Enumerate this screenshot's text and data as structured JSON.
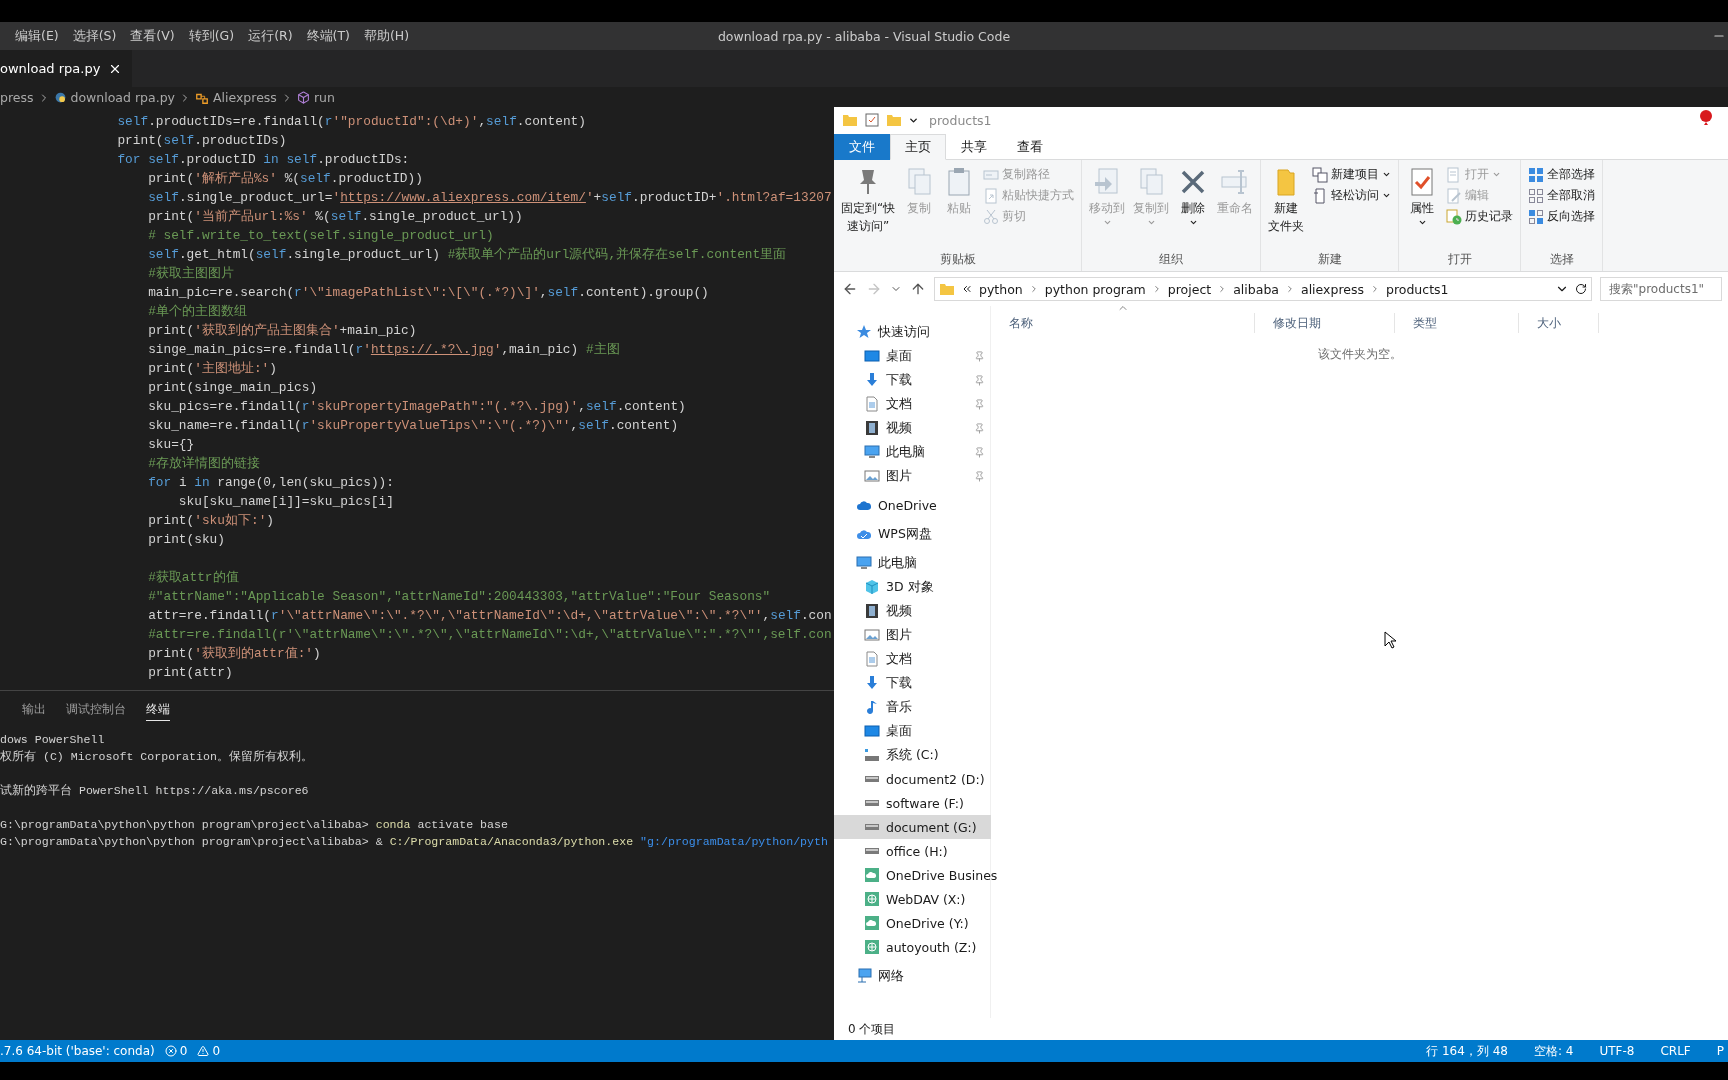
{
  "vscode": {
    "menu": [
      "编辑(E)",
      "选择(S)",
      "查看(V)",
      "转到(G)",
      "运行(R)",
      "终端(T)",
      "帮助(H)"
    ],
    "title": "download rpa.py - alibaba - Visual Studio Code",
    "tab": {
      "label": "ownload rpa.py"
    },
    "breadcrumb": [
      {
        "label": "press",
        "kind": "folder"
      },
      {
        "label": "download rpa.py",
        "kind": "python"
      },
      {
        "label": "Aliexpress",
        "kind": "class"
      },
      {
        "label": "run",
        "kind": "method"
      }
    ],
    "code": [
      {
        "tokens": [
          {
            "kind": "self",
            "text": "        self"
          },
          {
            "kind": "plain",
            "text": ".productIDs=re.findall("
          },
          {
            "kind": "keyword",
            "text": "r"
          },
          {
            "kind": "string",
            "text": "'\"productId\":(\\d+)'"
          },
          {
            "kind": "plain",
            "text": ","
          },
          {
            "kind": "self",
            "text": "self"
          },
          {
            "kind": "plain",
            "text": ".content)"
          }
        ]
      },
      {
        "tokens": [
          {
            "kind": "plain",
            "text": "        print("
          },
          {
            "kind": "self",
            "text": "self"
          },
          {
            "kind": "plain",
            "text": ".productIDs)"
          }
        ]
      },
      {
        "tokens": [
          {
            "kind": "keyword",
            "text": "        for "
          },
          {
            "kind": "self",
            "text": "self"
          },
          {
            "kind": "plain",
            "text": ".productID "
          },
          {
            "kind": "keyword",
            "text": "in "
          },
          {
            "kind": "self",
            "text": "self"
          },
          {
            "kind": "plain",
            "text": ".productIDs:"
          }
        ]
      },
      {
        "tokens": [
          {
            "kind": "plain",
            "text": "            print("
          },
          {
            "kind": "string",
            "text": "'解析产品%s'"
          },
          {
            "kind": "plain",
            "text": " %("
          },
          {
            "kind": "self",
            "text": "self"
          },
          {
            "kind": "plain",
            "text": ".productID))"
          }
        ]
      },
      {
        "tokens": [
          {
            "kind": "self",
            "text": "            self"
          },
          {
            "kind": "plain",
            "text": ".single_product_url="
          },
          {
            "kind": "string",
            "text": "'"
          },
          {
            "kind": "url",
            "text": "https://www.aliexpress.com/item/"
          },
          {
            "kind": "string",
            "text": "'"
          },
          {
            "kind": "plain",
            "text": "+"
          },
          {
            "kind": "self",
            "text": "self"
          },
          {
            "kind": "plain",
            "text": ".productID+"
          },
          {
            "kind": "string",
            "text": "'.html?af=13207"
          }
        ]
      },
      {
        "tokens": [
          {
            "kind": "plain",
            "text": "            print("
          },
          {
            "kind": "string",
            "text": "'当前产品url:%s'"
          },
          {
            "kind": "plain",
            "text": " %("
          },
          {
            "kind": "self",
            "text": "self"
          },
          {
            "kind": "plain",
            "text": ".single_product_url))"
          }
        ]
      },
      {
        "tokens": [
          {
            "kind": "comment",
            "text": "            # self.write_to_text(self.single_product_url)"
          }
        ]
      },
      {
        "tokens": [
          {
            "kind": "self",
            "text": "            self"
          },
          {
            "kind": "plain",
            "text": ".get_html("
          },
          {
            "kind": "self",
            "text": "self"
          },
          {
            "kind": "plain",
            "text": ".single_product_url) "
          },
          {
            "kind": "comment",
            "text": "#获取单个产品的url源代码,并保存在self.content里面"
          }
        ]
      },
      {
        "tokens": [
          {
            "kind": "comment",
            "text": "            #获取主图图片"
          }
        ]
      },
      {
        "tokens": [
          {
            "kind": "plain",
            "text": "            main_pic=re.search("
          },
          {
            "kind": "keyword",
            "text": "r"
          },
          {
            "kind": "string",
            "text": "'\\\"imagePathList\\\":\\[\\\"(.*?)\\]'"
          },
          {
            "kind": "plain",
            "text": ","
          },
          {
            "kind": "self",
            "text": "self"
          },
          {
            "kind": "plain",
            "text": ".content).group()"
          }
        ]
      },
      {
        "tokens": [
          {
            "kind": "comment",
            "text": "            #单个的主图数组"
          }
        ]
      },
      {
        "tokens": [
          {
            "kind": "plain",
            "text": "            print("
          },
          {
            "kind": "string",
            "text": "'获取到的产品主图集合'"
          },
          {
            "kind": "plain",
            "text": "+main_pic)"
          }
        ]
      },
      {
        "tokens": [
          {
            "kind": "plain",
            "text": "            singe_main_pics=re.findall("
          },
          {
            "kind": "keyword",
            "text": "r"
          },
          {
            "kind": "string",
            "text": "'"
          },
          {
            "kind": "url",
            "text": "https://.*?\\.jpg"
          },
          {
            "kind": "string",
            "text": "'"
          },
          {
            "kind": "plain",
            "text": ",main_pic) "
          },
          {
            "kind": "comment",
            "text": "#主图"
          }
        ]
      },
      {
        "tokens": [
          {
            "kind": "plain",
            "text": "            print("
          },
          {
            "kind": "string",
            "text": "'主图地址:'"
          },
          {
            "kind": "plain",
            "text": ")"
          }
        ]
      },
      {
        "tokens": [
          {
            "kind": "plain",
            "text": "            print(singe_main_pics)"
          }
        ]
      },
      {
        "tokens": [
          {
            "kind": "plain",
            "text": "            sku_pics=re.findall("
          },
          {
            "kind": "keyword",
            "text": "r"
          },
          {
            "kind": "string",
            "text": "'skuPropertyImagePath\":\"(.*?\\.jpg)'"
          },
          {
            "kind": "plain",
            "text": ","
          },
          {
            "kind": "self",
            "text": "self"
          },
          {
            "kind": "plain",
            "text": ".content)"
          }
        ]
      },
      {
        "tokens": [
          {
            "kind": "plain",
            "text": "            sku_name=re.findall("
          },
          {
            "kind": "keyword",
            "text": "r"
          },
          {
            "kind": "string",
            "text": "'skuPropertyValueTips\\\":\\\"(.*?)\\\"'"
          },
          {
            "kind": "plain",
            "text": ","
          },
          {
            "kind": "self",
            "text": "self"
          },
          {
            "kind": "plain",
            "text": ".content)"
          }
        ]
      },
      {
        "tokens": [
          {
            "kind": "plain",
            "text": "            sku={}"
          }
        ]
      },
      {
        "tokens": [
          {
            "kind": "comment",
            "text": "            #存放详情图的链接"
          }
        ]
      },
      {
        "tokens": [
          {
            "kind": "keyword",
            "text": "            for"
          },
          {
            "kind": "plain",
            "text": " i "
          },
          {
            "kind": "keyword",
            "text": "in"
          },
          {
            "kind": "plain",
            "text": " range(0,len(sku_pics)):"
          }
        ]
      },
      {
        "tokens": [
          {
            "kind": "plain",
            "text": "                sku[sku_name[i]]=sku_pics[i]"
          }
        ]
      },
      {
        "tokens": [
          {
            "kind": "plain",
            "text": "            print("
          },
          {
            "kind": "string",
            "text": "'sku如下:'"
          },
          {
            "kind": "plain",
            "text": ")"
          }
        ]
      },
      {
        "tokens": [
          {
            "kind": "plain",
            "text": "            print(sku)"
          }
        ]
      },
      {
        "gap_before": true,
        "tokens": [
          {
            "kind": "comment",
            "text": "            #获取attr的值"
          }
        ]
      },
      {
        "tokens": [
          {
            "kind": "comment",
            "text": "            #\"attrName\":\"Applicable Season\",\"attrNameId\":200443303,\"attrValue\":\"Four Seasons\""
          }
        ]
      },
      {
        "tokens": [
          {
            "kind": "plain",
            "text": "            attr=re.findall("
          },
          {
            "kind": "keyword",
            "text": "r"
          },
          {
            "kind": "string",
            "text": "'\\\"attrName\\\":\\\".*?\\\",\\\"attrNameId\\\":\\d+,\\\"attrValue\\\":\\\".*?\\\"'"
          },
          {
            "kind": "plain",
            "text": ","
          },
          {
            "kind": "self",
            "text": "self"
          },
          {
            "kind": "plain",
            "text": ".con"
          }
        ]
      },
      {
        "tokens": [
          {
            "kind": "comment",
            "text": "            #attr=re.findall(r'\\\"attrName\\\":\\\".*?\\\",\\\"attrNameId\\\":\\d+,\\\"attrValue\\\":\".*?\\\"',self.con"
          }
        ]
      },
      {
        "tokens": [
          {
            "kind": "plain",
            "text": "            print("
          },
          {
            "kind": "string",
            "text": "'获取到的attr值:'"
          },
          {
            "kind": "plain",
            "text": ")"
          }
        ]
      },
      {
        "tokens": [
          {
            "kind": "plain",
            "text": "            print(attr)"
          }
        ]
      }
    ],
    "panel_tabs": [
      {
        "label": "输出",
        "selected": false
      },
      {
        "label": "调试控制台",
        "selected": false
      },
      {
        "label": "终端",
        "selected": true
      }
    ],
    "terminal": [
      {
        "tokens": [
          {
            "kind": "plain",
            "text": "dows PowerShell"
          }
        ]
      },
      {
        "tokens": [
          {
            "kind": "plain",
            "text": "权所有 (C) Microsoft Corporation。保留所有权利。"
          }
        ]
      },
      {
        "gap_before": true,
        "tokens": [
          {
            "kind": "plain",
            "text": "试新的跨平台 PowerShell https://aka.ms/pscore6"
          }
        ]
      },
      {
        "gap_before": true,
        "tokens": [
          {
            "kind": "plain",
            "text": "G:\\programData\\python\\python program\\project\\alibaba> "
          },
          {
            "kind": "command",
            "text": "conda"
          },
          {
            "kind": "plain",
            "text": " activate base"
          }
        ]
      },
      {
        "tokens": [
          {
            "kind": "plain",
            "text": "G:\\programData\\python\\python program\\project\\alibaba> & "
          },
          {
            "kind": "command",
            "text": "C:/ProgramData/Anaconda3/python.exe"
          },
          {
            "kind": "argument",
            "text": " \"g:/programData/python/pyth"
          }
        ]
      }
    ],
    "status_bar": {
      "left": [
        {
          "kind": "text",
          "text": ".7.6 64-bit ('base': conda)"
        },
        {
          "kind": "errors",
          "text": "0"
        },
        {
          "kind": "warnings",
          "text": "0"
        }
      ],
      "right": [
        "行 164，列 48",
        "空格: 4",
        "UTF-8",
        "CRLF",
        "P"
      ]
    }
  },
  "explorer": {
    "title": "products1",
    "ribbon": {
      "tabs": [
        {
          "label": "文件",
          "kind": "file",
          "selected": false
        },
        {
          "label": "主页",
          "kind": "tab",
          "selected": true
        },
        {
          "label": "共享",
          "kind": "tab",
          "selected": false
        },
        {
          "label": "查看",
          "kind": "tab",
          "selected": false
        }
      ],
      "groups": [
        {
          "label": "剪贴板",
          "large": [
            {
              "label_lines": [
                "固定到“快",
                "速访问”"
              ],
              "kind": "pin",
              "disabled": false
            },
            {
              "label": "复制",
              "kind": "copy",
              "disabled": true
            },
            {
              "label": "粘贴",
              "kind": "paste",
              "disabled": true
            }
          ],
          "small": [
            {
              "label": "复制路径",
              "kind": "copypath",
              "disabled": true
            },
            {
              "label": "粘贴快捷方式",
              "kind": "pasteshortcut",
              "disabled": true
            },
            {
              "label": "剪切",
              "kind": "cut",
              "disabled": true
            }
          ]
        },
        {
          "label": "组织",
          "large": [
            {
              "label": "移动到",
              "kind": "moveto",
              "disabled": true,
              "menu": true
            },
            {
              "label": "复制到",
              "kind": "copyto",
              "disabled": true,
              "menu": true
            },
            {
              "label": "删除",
              "kind": "delete",
              "disabled": false,
              "menu": true
            },
            {
              "label": "重命名",
              "kind": "rename",
              "disabled": true
            }
          ]
        },
        {
          "label": "新建",
          "large": [
            {
              "label_lines": [
                "新建",
                "文件夹"
              ],
              "kind": "newfolder",
              "disabled": false
            }
          ],
          "small": [
            {
              "label": "新建项目",
              "kind": "newitem",
              "disabled": false,
              "menu": true
            },
            {
              "label": "轻松访问",
              "kind": "easyaccess",
              "disabled": false,
              "menu": true
            }
          ]
        },
        {
          "label": "打开",
          "large": [
            {
              "label": "属性",
              "kind": "properties",
              "disabled": false,
              "menu": true
            }
          ],
          "small": [
            {
              "label": "打开",
              "kind": "open",
              "disabled": true,
              "menu": true
            },
            {
              "label": "编辑",
              "kind": "edit",
              "disabled": true
            },
            {
              "label": "历史记录",
              "kind": "history",
              "disabled": false
            }
          ]
        },
        {
          "label": "选择",
          "small": [
            {
              "label": "全部选择",
              "kind": "selectall",
              "disabled": false
            },
            {
              "label": "全部取消",
              "kind": "selectnone",
              "disabled": false
            },
            {
              "label": "反向选择",
              "kind": "invert",
              "disabled": false
            }
          ]
        }
      ]
    },
    "address": [
      "python",
      "python program",
      "project",
      "alibaba",
      "aliexpress",
      "products1"
    ],
    "search": {
      "placeholder": "搜索\"products1\""
    },
    "nav": [
      {
        "label": "快速访问",
        "kind": "star",
        "selected": false,
        "children": [
          {
            "label": "桌面",
            "kind": "desktop",
            "pinned": true,
            "selected": false
          },
          {
            "label": "下载",
            "kind": "download",
            "pinned": true,
            "selected": false
          },
          {
            "label": "文档",
            "kind": "doc",
            "pinned": true,
            "selected": false
          },
          {
            "label": "视频",
            "kind": "video",
            "pinned": true,
            "selected": false
          },
          {
            "label": "此电脑",
            "kind": "pc",
            "pinned": true,
            "selected": false
          },
          {
            "label": "图片",
            "kind": "picture",
            "pinned": true,
            "selected": false
          }
        ]
      },
      {
        "label": "OneDrive",
        "kind": "onedrive",
        "selected": false
      },
      {
        "label": "WPS网盘",
        "kind": "wps",
        "selected": false
      },
      {
        "label": "此电脑",
        "kind": "pc",
        "selected": false,
        "children": [
          {
            "label": "3D 对象",
            "kind": "cube",
            "selected": false
          },
          {
            "label": "视频",
            "kind": "video",
            "selected": false
          },
          {
            "label": "图片",
            "kind": "picture",
            "selected": false
          },
          {
            "label": "文档",
            "kind": "doc",
            "selected": false
          },
          {
            "label": "下载",
            "kind": "download",
            "selected": false
          },
          {
            "label": "音乐",
            "kind": "music",
            "selected": false
          },
          {
            "label": "桌面",
            "kind": "desktop",
            "selected": false
          },
          {
            "label": "系统 (C:)",
            "kind": "sysdrive",
            "selected": false
          },
          {
            "label": "document2 (D:)",
            "kind": "drive",
            "selected": false
          },
          {
            "label": "software (F:)",
            "kind": "drive",
            "selected": false
          },
          {
            "label": "document (G:)",
            "kind": "drive",
            "selected": true
          },
          {
            "label": "office (H:)",
            "kind": "drive",
            "selected": false
          },
          {
            "label": "OneDrive Busines",
            "kind": "netdrive",
            "selected": false
          },
          {
            "label": "WebDAV (X:)",
            "kind": "webdav",
            "selected": false
          },
          {
            "label": "OneDrive (Y:)",
            "kind": "netdrive",
            "selected": false
          },
          {
            "label": "autoyouth (Z:)",
            "kind": "webdav",
            "selected": false
          }
        ]
      },
      {
        "label": "网络",
        "kind": "network",
        "selected": false
      }
    ],
    "columns": [
      "名称",
      "修改日期",
      "类型",
      "大小"
    ],
    "empty_text": "该文件夹为空。",
    "status": "0 个项目"
  }
}
